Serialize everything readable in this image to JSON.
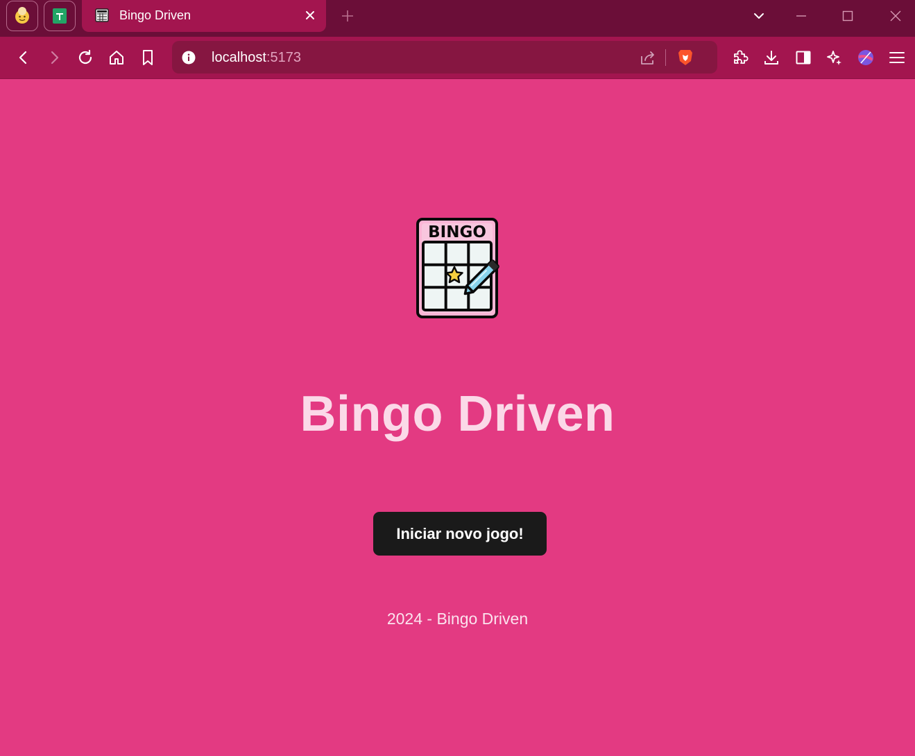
{
  "browser": {
    "tab": {
      "title": "Bingo Driven"
    },
    "address": {
      "host": "localhost",
      "port": ":5173"
    },
    "colors": {
      "titlebar": "#6b0e38",
      "toolbar": "#a3154f",
      "urlbar": "#861641"
    },
    "icons": {
      "profile": "profile-avatar-icon",
      "sheets": "google-sheets-icon",
      "back": "arrow-left-icon",
      "forward": "arrow-right-icon",
      "reload": "reload-icon",
      "home": "home-icon",
      "bookmark": "bookmark-icon",
      "info": "info-icon",
      "share": "share-icon",
      "brave": "brave-shields-icon",
      "extensions": "puzzle-icon",
      "downloads": "download-icon",
      "sidebar": "sidebar-icon",
      "leo": "leo-ai-icon",
      "wallet": "wallet-icon",
      "menu": "hamburger-menu-icon"
    }
  },
  "page": {
    "background": "#e33a82",
    "logo_text": "BINGO",
    "title": "Bingo Driven",
    "start_button": "Iniciar novo jogo!",
    "footer": "2024 - Bingo Driven"
  }
}
